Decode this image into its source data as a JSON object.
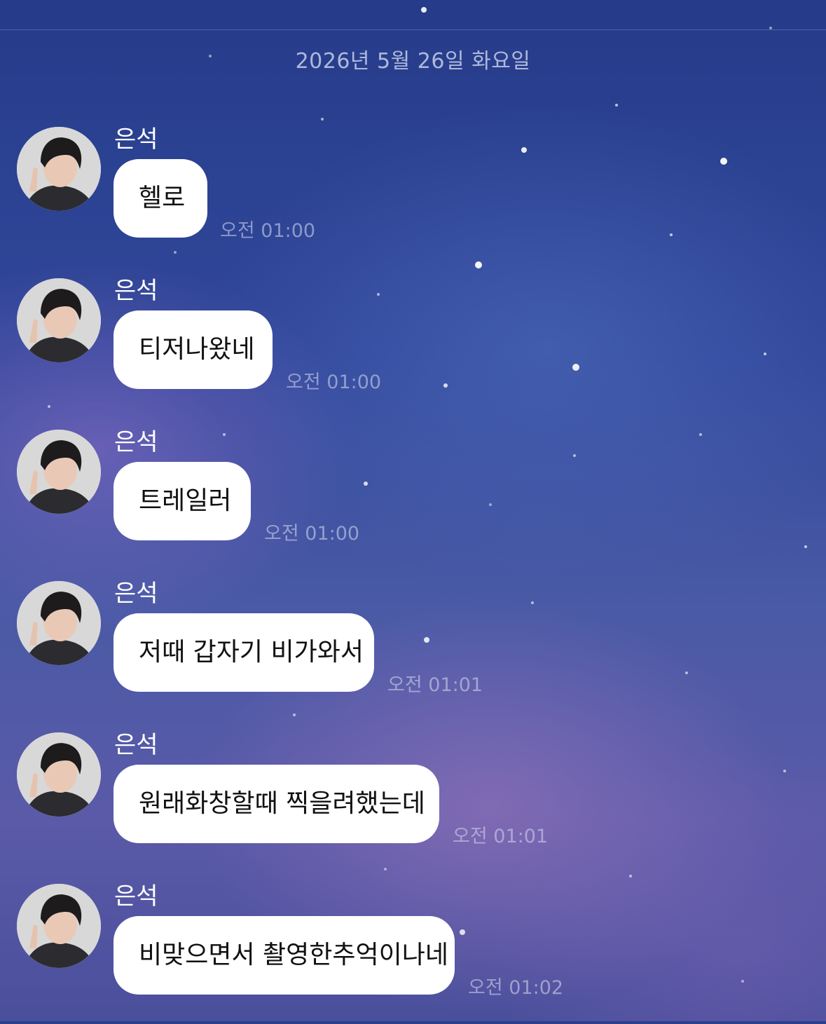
{
  "chat": {
    "date_divider": "2026년 5월 26일 화요일",
    "messages": [
      {
        "sender": "은석",
        "text": "헬로",
        "time": "오전 01:00"
      },
      {
        "sender": "은석",
        "text": "티저나왔네",
        "time": "오전 01:00"
      },
      {
        "sender": "은석",
        "text": "트레일러",
        "time": "오전 01:00"
      },
      {
        "sender": "은석",
        "text": "저때 갑자기 비가와서",
        "time": "오전 01:01"
      },
      {
        "sender": "은석",
        "text": "원래화창할때 찍을려했는데",
        "time": "오전 01:01"
      },
      {
        "sender": "은석",
        "text": "비맞으면서 촬영한추억이나네",
        "time": "오전 01:02"
      }
    ]
  },
  "colors": {
    "bubble": "#ffffff",
    "sender_name": "#ffffff",
    "background_primary": "#2b3f8c"
  },
  "icons": {
    "avatar": "profile-photo"
  }
}
